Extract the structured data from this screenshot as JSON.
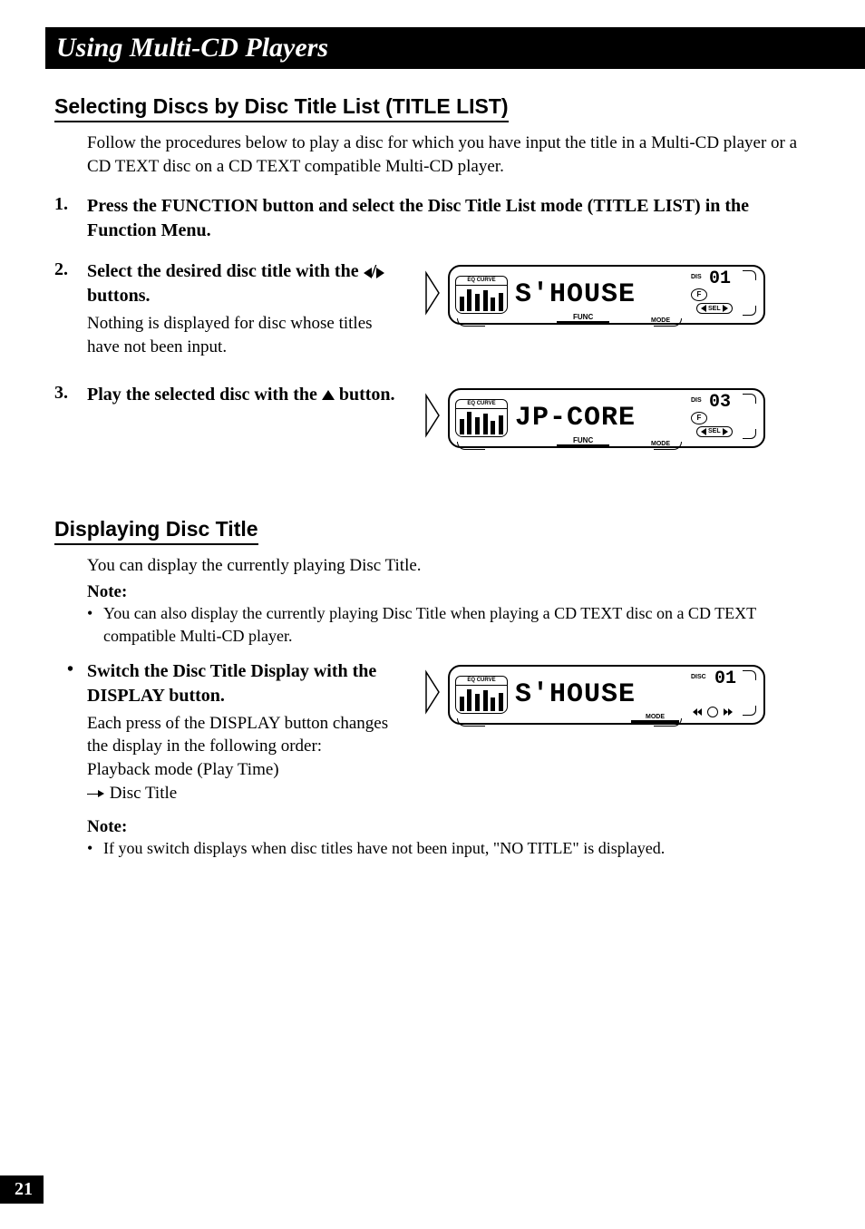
{
  "titleBar": "Using Multi-CD Players",
  "section1": {
    "heading": "Selecting Discs by Disc Title List (TITLE LIST)",
    "intro": "Follow the procedures below to play a disc for which you have input the title in a Multi-CD player or a CD TEXT disc on a CD TEXT compatible Multi-CD player.",
    "step1": {
      "num": "1.",
      "bold": "Press the FUNCTION button and select the Disc Title List mode (TITLE LIST) in the Function Menu."
    },
    "step2": {
      "num": "2.",
      "bold_a": "Select the desired disc title with the ",
      "bold_b": " buttons.",
      "text": "Nothing is displayed for disc whose titles have not been input.",
      "lcd": "S'HOUSE",
      "disc": "01"
    },
    "step3": {
      "num": "3.",
      "bold_a": "Play the selected disc with the ",
      "bold_b": " button.",
      "lcd": "JP-CORE",
      "disc": "03"
    }
  },
  "section2": {
    "heading": "Displaying Disc Title",
    "intro": "You can display the currently playing Disc Title.",
    "note1_label": "Note:",
    "note1_text": "You can also display the currently playing Disc Title when playing a CD TEXT disc on a CD TEXT compatible Multi-CD player.",
    "bullet": {
      "bold": "Switch the Disc Title Display with the DISPLAY button.",
      "text1": "Each press of the DISPLAY button changes the display in the following order:",
      "text2": "Playback mode (Play Time)",
      "text3": "Disc Title",
      "lcd": "S'HOUSE",
      "disc": "01"
    },
    "note2_label": "Note:",
    "note2_text": "If you switch displays when disc titles have not been input, \"NO TITLE\" is displayed."
  },
  "panelLabels": {
    "eq": "EQ CURVE",
    "func": "FUNC",
    "mode": "MODE",
    "discLabel": "DIS",
    "discLabel2": "DISC",
    "sel": "SEL",
    "f": "F"
  },
  "pageNumber": "21"
}
